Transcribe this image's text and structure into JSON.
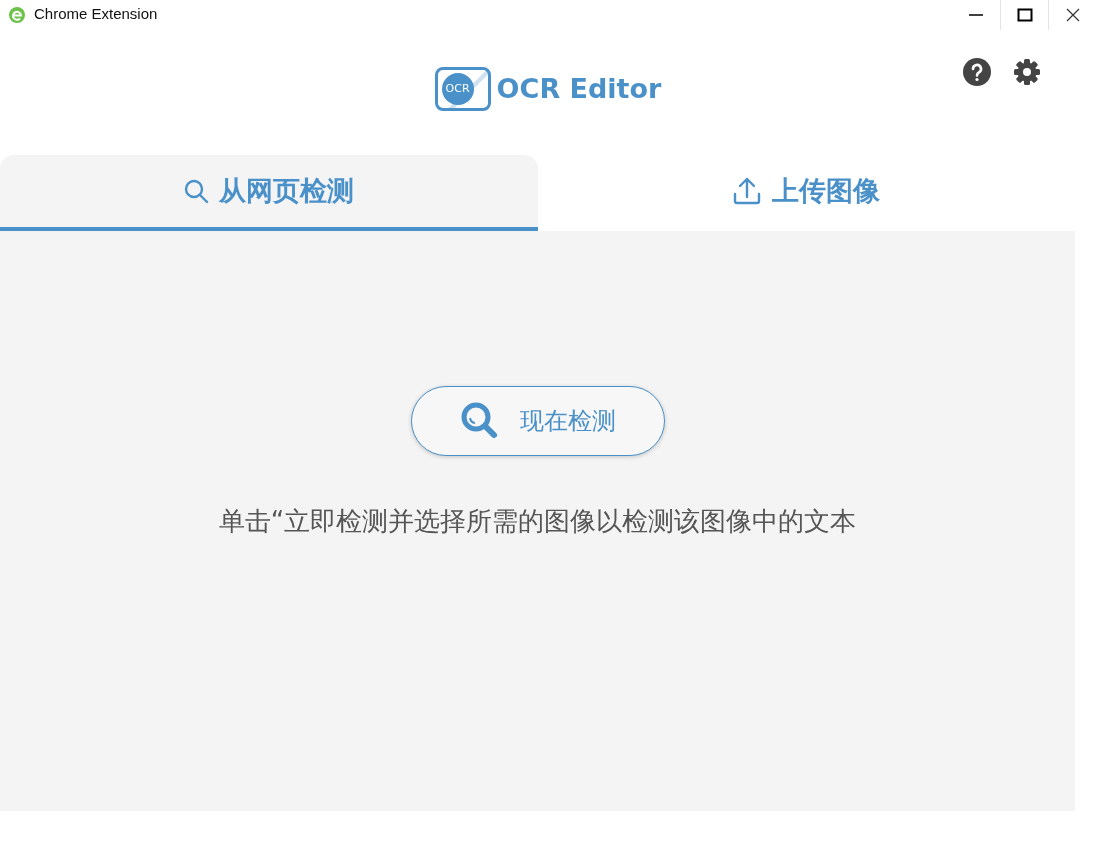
{
  "window": {
    "title": "Chrome Extension"
  },
  "logo": {
    "badge": "OCR",
    "name": "OCR Editor"
  },
  "tabs": [
    {
      "kind": "search",
      "label": "从网页检测",
      "selected": true
    },
    {
      "kind": "upload",
      "label": "上传图像",
      "selected": false
    }
  ],
  "detect_button": {
    "label": "现在检测"
  },
  "hint": "单击“立即检测并选择所需的图像以检测该图像中的文本"
}
